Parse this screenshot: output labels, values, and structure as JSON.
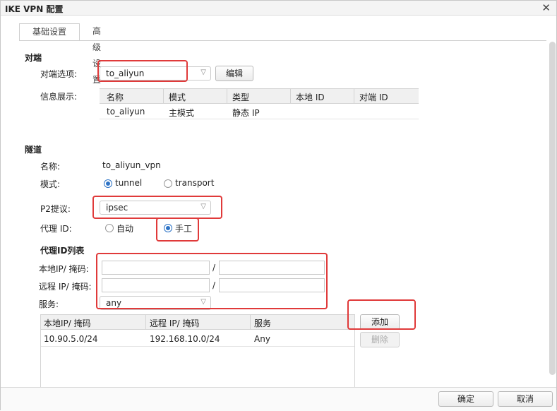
{
  "window": {
    "title": "IKE VPN 配置"
  },
  "tabs": [
    {
      "label": "基础设置"
    },
    {
      "label": "高级设置"
    }
  ],
  "peer": {
    "section_title": "对端",
    "option_label": "对端选项:",
    "option_value": "to_aliyun",
    "edit_button": "编辑",
    "info_label": "信息展示:",
    "table": {
      "columns": [
        "名称",
        "模式",
        "类型",
        "本地 ID",
        "对端 ID"
      ],
      "rows": [
        [
          "to_aliyun",
          "主模式",
          "静态 IP",
          "",
          ""
        ]
      ]
    }
  },
  "tunnel": {
    "section_title": "隧道",
    "name_label": "名称:",
    "name_value": "to_aliyun_vpn",
    "mode_label": "模式:",
    "mode_options": [
      "tunnel",
      "transport"
    ],
    "mode_selected": "tunnel",
    "p2_label": "P2提议:",
    "p2_value": "ipsec",
    "proxy_label": "代理 ID:",
    "proxy_options": [
      "自动",
      "手工"
    ],
    "proxy_selected": "手工"
  },
  "proxy_list": {
    "section_title": "代理ID列表",
    "local_label": "本地IP/ 掩码:",
    "remote_label": "远程 IP/ 掩码:",
    "service_label": "服务:",
    "slash": "/",
    "local_ip": "",
    "local_mask": "",
    "remote_ip": "",
    "remote_mask": "",
    "service_value": "any",
    "add_button": "添加",
    "delete_button": "删除",
    "table": {
      "columns": [
        "本地IP/ 掩码",
        "远程 IP/ 掩码",
        "服务"
      ],
      "rows": [
        [
          "10.90.5.0/24",
          "192.168.10.0/24",
          "Any"
        ]
      ]
    }
  },
  "footer": {
    "ok_button": "确定",
    "cancel_button": "取消"
  },
  "colors": {
    "annotation": "#e03a3a",
    "radio_accent": "#2d73c6"
  }
}
